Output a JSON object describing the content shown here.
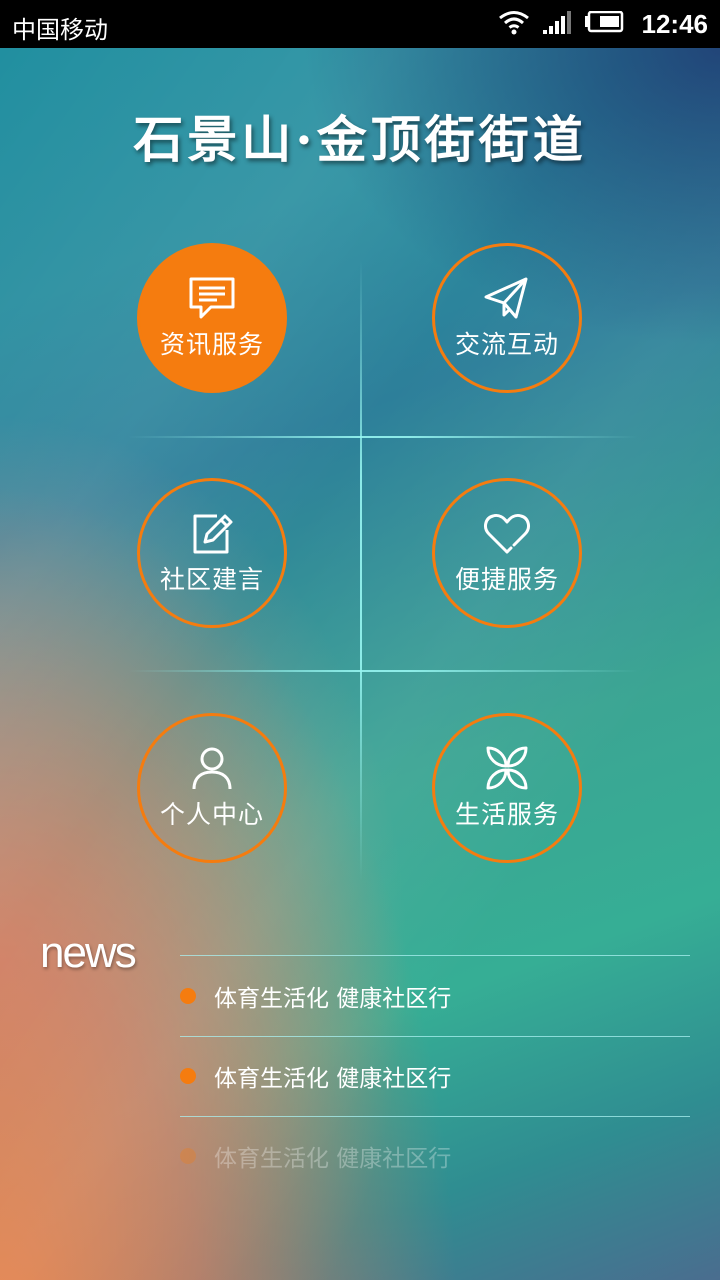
{
  "status_bar": {
    "carrier": "中国移动",
    "time": "12:46",
    "icons": [
      "wifi-icon",
      "signal-icon",
      "battery-icon"
    ]
  },
  "app": {
    "title": "石景山·金顶街街道"
  },
  "menu": [
    {
      "label": "资讯服务",
      "icon": "message-icon",
      "active": true
    },
    {
      "label": "交流互动",
      "icon": "paper-plane-icon",
      "active": false
    },
    {
      "label": "社区建言",
      "icon": "edit-icon",
      "active": false
    },
    {
      "label": "便捷服务",
      "icon": "heart-icon",
      "active": false
    },
    {
      "label": "个人中心",
      "icon": "user-icon",
      "active": false
    },
    {
      "label": "生活服务",
      "icon": "flower-icon",
      "active": false
    }
  ],
  "news": {
    "heading": "news",
    "items": [
      {
        "title": "体育生活化 健康社区行"
      },
      {
        "title": "体育生活化 健康社区行"
      },
      {
        "title": "体育生活化 健康社区行"
      }
    ]
  },
  "colors": {
    "accent": "#f57c0f",
    "status_bar": "#000000",
    "divider": "#a0eeee"
  }
}
